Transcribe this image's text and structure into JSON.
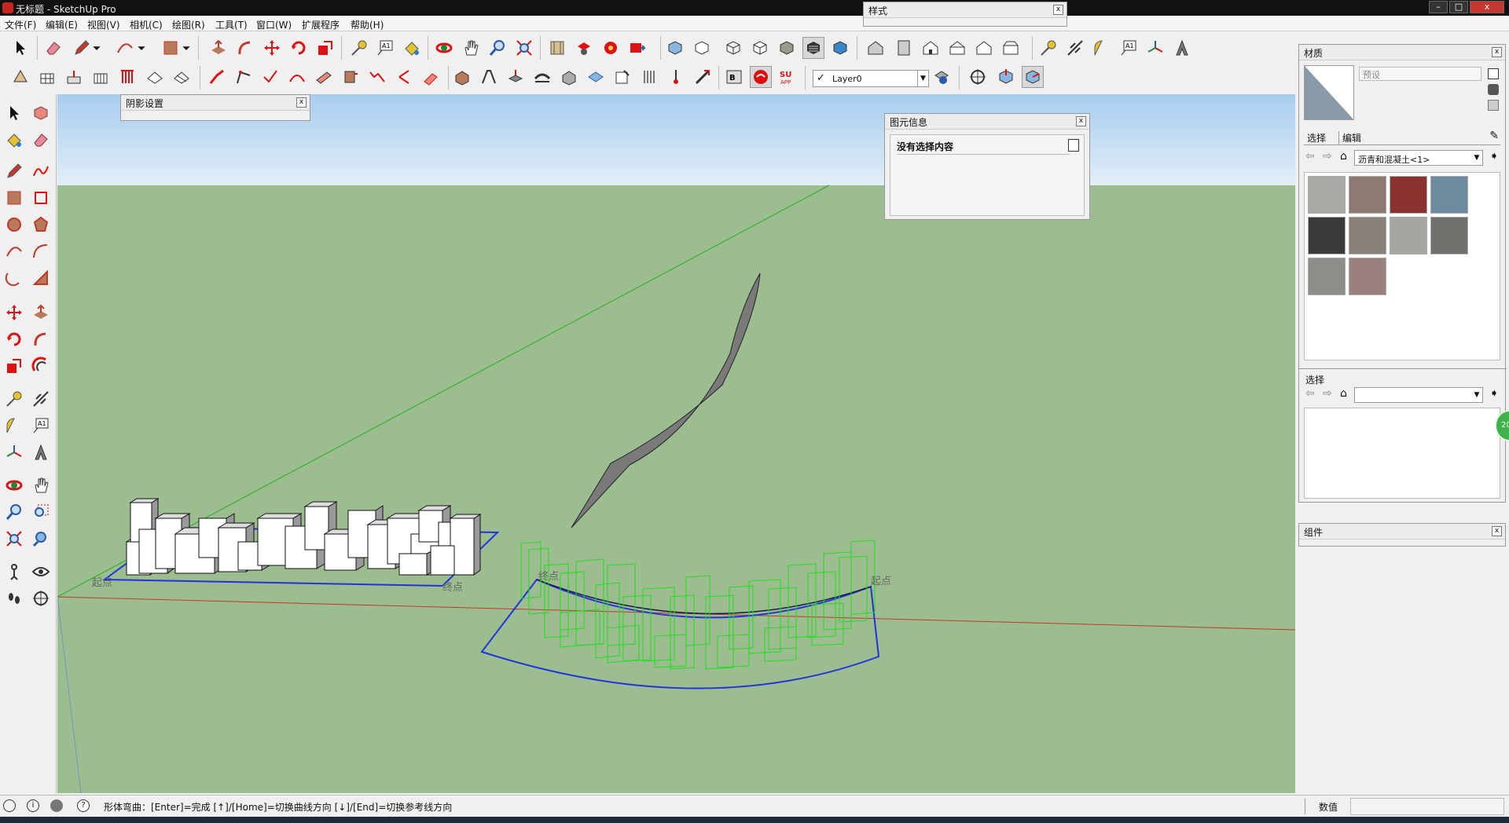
{
  "window": {
    "title": "无标题 - SketchUp Pro",
    "minimize": "–",
    "maximize": "□",
    "close": "x"
  },
  "menu": [
    "文件(F)",
    "编辑(E)",
    "视图(V)",
    "相机(C)",
    "绘图(R)",
    "工具(T)",
    "窗口(W)",
    "扩展程序",
    "帮助(H)"
  ],
  "styles_panel": {
    "title": "样式",
    "close": "x"
  },
  "toolbar2": {
    "layer_name": "Layer0"
  },
  "shadow_panel": {
    "title": "阴影设置",
    "close": "x"
  },
  "entity_info": {
    "title": "图元信息",
    "close": "x",
    "content": "没有选择内容"
  },
  "viewport": {
    "labels": {
      "start_left": "起点",
      "end_left": "终点",
      "end_right": "终点",
      "start_right": "起点"
    },
    "badge": "20"
  },
  "materials": {
    "title": "材质",
    "close": "x",
    "name_placeholder": "预设",
    "tabs": [
      "选择",
      "编辑"
    ],
    "library": "沥青和混凝土<1>",
    "swatch_colors": [
      "#a9a9a5",
      "#8d7a72",
      "#8a3330",
      "#6f8ba0",
      "#3d3a3c",
      "#8a817a",
      "#a6a6a1",
      "#70706d",
      "#8f8d89",
      "#9b7f7e"
    ],
    "secondary_title": "选择"
  },
  "components": {
    "title": "组件",
    "close": "x"
  },
  "statusbar": {
    "message": "形体弯曲：[Enter]=完成 [↑]/[Home]=切换曲线方向 [↓]/[End]=切换参考线方向",
    "measure_label": "数值",
    "measure_value": ""
  }
}
